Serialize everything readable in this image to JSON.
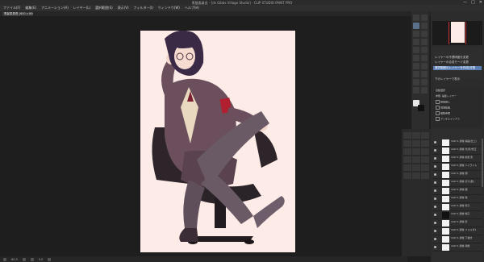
{
  "window": {
    "title": "黒髪委員長 - [ds Gibbs Village Studio] - CLIP STUDIO PAINT PRO",
    "controls": [
      "—",
      "□",
      "✕"
    ]
  },
  "menu": [
    "ファイル(F)",
    "編集(E)",
    "アニメーション(A)",
    "レイヤー(L)",
    "選択範囲(S)",
    "表示(V)",
    "フィルター(I)",
    "ウィンドウ(W)",
    "ヘルプ(H)"
  ],
  "document_tab": "黒髪委員長 (600 x 600px 72dpi 100%)",
  "status": {
    "zoom": "60.5",
    "angle": "0.0"
  },
  "sublayers": {
    "items": [
      "レイヤーの不透明度を変更",
      "レイヤーの合成モード変更",
      "選択範囲のレイヤーを作成/分割",
      "下のレイヤーで表示"
    ]
  },
  "tool_props": {
    "title": "自動選択",
    "rows": [
      "参照: 編集レイヤー",
      "隙間閉じ",
      "領域拡縮",
      "複数参照",
      "アンチエイリアス",
      "カラーの誤差"
    ]
  },
  "layers": [
    {
      "name": "100 % 通常  線画(仕上)"
    },
    {
      "name": "100 % 通常  光/影/修正"
    },
    {
      "name": "100 % 通常  前髪 影"
    },
    {
      "name": "100 % 通常  ハイライト"
    },
    {
      "name": "100 % 通常  顔"
    },
    {
      "name": "100 % 通常  塗り(肌)"
    },
    {
      "name": "100 % 通常  服"
    },
    {
      "name": "100 % 通常  靴"
    },
    {
      "name": "100 % 通常  椅子"
    },
    {
      "name": "100 % 通常  帽子"
    },
    {
      "name": "100 % 通常  影"
    },
    {
      "name": "100 % 通常  フォルダ1"
    },
    {
      "name": "100 % 通常  下描き"
    },
    {
      "name": "100 % 通常  用紙"
    }
  ],
  "colors": {
    "paper": "#fcebe7",
    "ui_dark": "#1f1f1f",
    "panel": "#2c2c2c",
    "selection": "#5b7fb5"
  }
}
